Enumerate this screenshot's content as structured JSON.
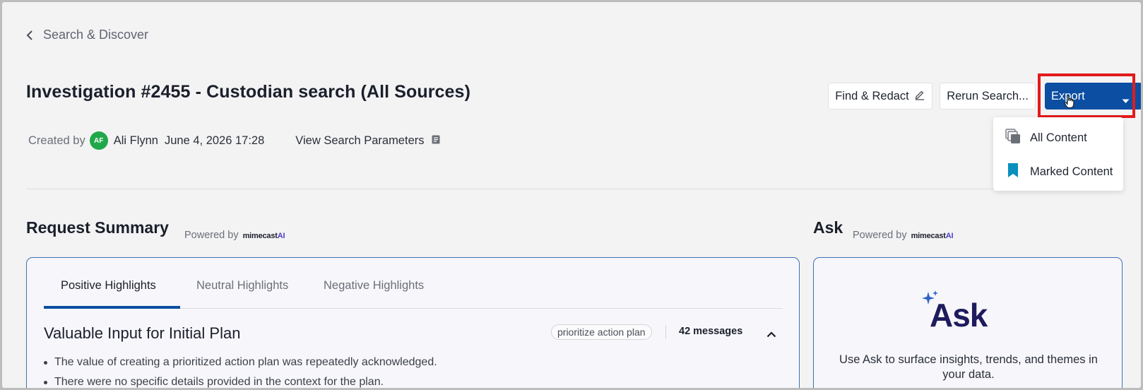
{
  "nav": {
    "back_label": "Search & Discover"
  },
  "header": {
    "title": "Investigation #2455 - Custodian search (All Sources)",
    "created_by_label": "Created by",
    "avatar_initials": "AF",
    "author": "Ali Flynn",
    "created_date": "June 4, 2026 17:28",
    "view_params_label": "View Search Parameters"
  },
  "toolbar": {
    "find_redact_label": "Find & Redact",
    "rerun_label": "Rerun Search...",
    "export_label": "Export"
  },
  "export_menu": {
    "items": [
      {
        "label": "All Content",
        "icon": "stack-icon"
      },
      {
        "label": "Marked Content",
        "icon": "bookmark-icon"
      }
    ]
  },
  "summary": {
    "title": "Request Summary",
    "powered_by": "Powered by",
    "brand_name": "mimecast",
    "brand_suffix": "AI",
    "tabs": [
      "Positive Highlights",
      "Neutral Highlights",
      "Negative Highlights"
    ],
    "active_tab": 0,
    "heading": "Valuable Input for Initial Plan",
    "tag": "prioritize action plan",
    "message_count": "42 messages",
    "bullets": [
      "The value of creating a prioritized action plan was repeatedly acknowledged.",
      "There were no specific details provided in the context for the plan."
    ]
  },
  "ask": {
    "title": "Ask",
    "powered_by": "Powered by",
    "brand_name": "mimecast",
    "brand_suffix": "AI",
    "logo_text": "Ask",
    "description": "Use Ask to surface insights, trends, and themes in your data."
  },
  "colors": {
    "primary": "#0b4ea2",
    "highlight": "#e21b1b",
    "avatar": "#1fa84a",
    "bookmark": "#0a8fbf",
    "ask_logo": "#1e1b5e"
  }
}
